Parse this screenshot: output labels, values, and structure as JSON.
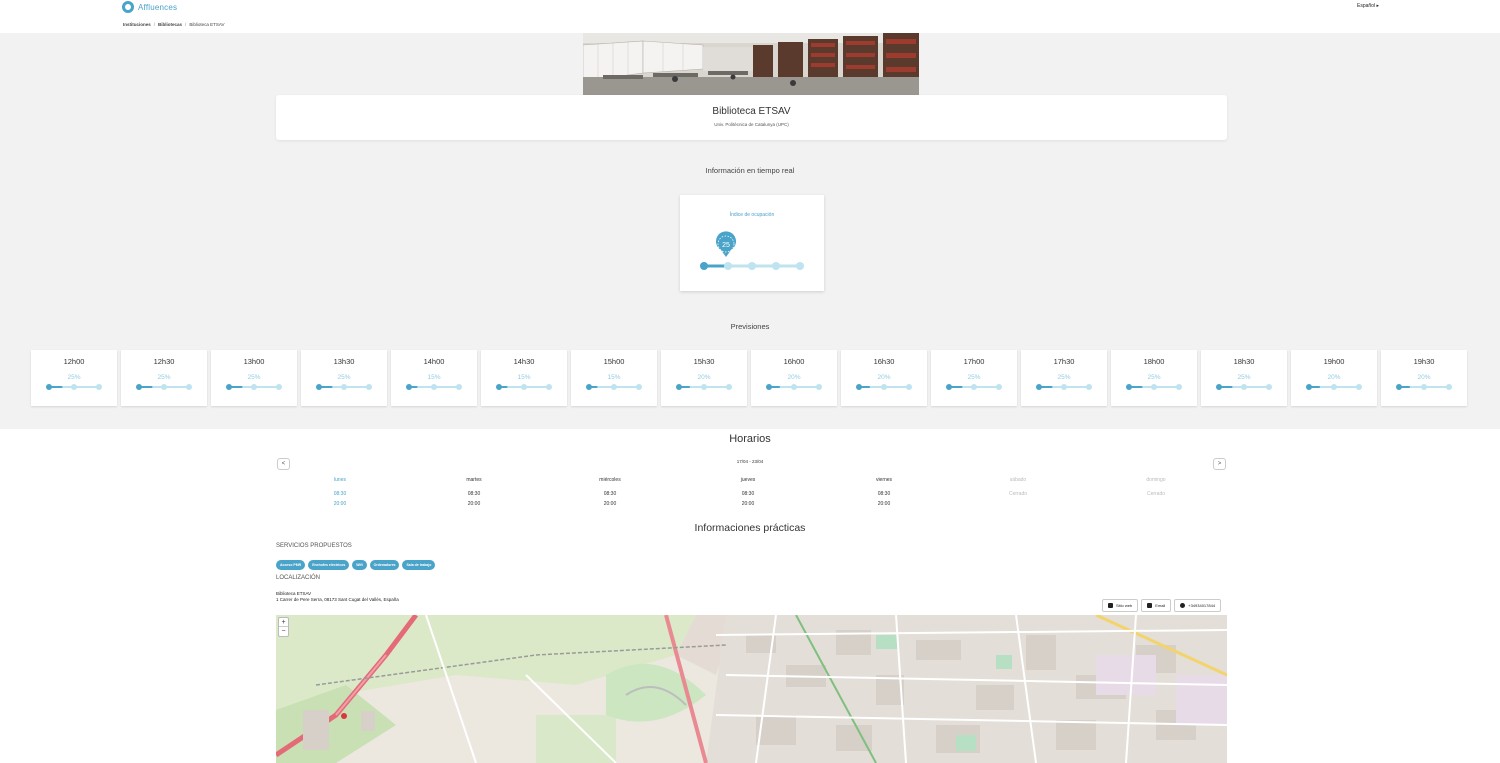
{
  "header": {
    "brand": "Affluences",
    "language": "Español ▸"
  },
  "breadcrumb": [
    {
      "label": "Instituciones"
    },
    {
      "label": "Bibliotecas"
    },
    {
      "label": "Biblioteca ETSAV"
    }
  ],
  "library": {
    "name": "Biblioteca ETSAV",
    "institution": "Univ. Politècnica de Catalunya (UPC)"
  },
  "realtime": {
    "title": "Información en tiempo real",
    "occupancy_label": "Índice de ocupación",
    "occupancy_value": "25",
    "occupancy_fraction": 0.25
  },
  "forecast": {
    "title": "Previsiones",
    "slots": [
      {
        "time": "12h00",
        "pct": "25%"
      },
      {
        "time": "12h30",
        "pct": "25%"
      },
      {
        "time": "13h00",
        "pct": "25%"
      },
      {
        "time": "13h30",
        "pct": "25%"
      },
      {
        "time": "14h00",
        "pct": "15%"
      },
      {
        "time": "14h30",
        "pct": "15%"
      },
      {
        "time": "15h00",
        "pct": "15%"
      },
      {
        "time": "15h30",
        "pct": "20%"
      },
      {
        "time": "16h00",
        "pct": "20%"
      },
      {
        "time": "16h30",
        "pct": "20%"
      },
      {
        "time": "17h00",
        "pct": "25%"
      },
      {
        "time": "17h30",
        "pct": "25%"
      },
      {
        "time": "18h00",
        "pct": "25%"
      },
      {
        "time": "18h30",
        "pct": "25%"
      },
      {
        "time": "19h00",
        "pct": "20%"
      },
      {
        "time": "19h30",
        "pct": "20%"
      }
    ]
  },
  "schedule": {
    "title": "Horarios",
    "prev": "<",
    "next": ">",
    "week": "17/04 - 23/04",
    "days": [
      {
        "name": "lunes",
        "open": "08:30",
        "close": "20:00",
        "status": "",
        "today": true,
        "closed": false
      },
      {
        "name": "martes",
        "open": "08:30",
        "close": "20:00",
        "status": "",
        "today": false,
        "closed": false
      },
      {
        "name": "miércoles",
        "open": "08:30",
        "close": "20:00",
        "status": "",
        "today": false,
        "closed": false
      },
      {
        "name": "jueves",
        "open": "08:30",
        "close": "20:00",
        "status": "",
        "today": false,
        "closed": false
      },
      {
        "name": "viernes",
        "open": "08:30",
        "close": "20:00",
        "status": "",
        "today": false,
        "closed": false
      },
      {
        "name": "sábado",
        "open": "",
        "close": "",
        "status": "Cerrado",
        "today": false,
        "closed": true
      },
      {
        "name": "domingo",
        "open": "",
        "close": "",
        "status": "Cerrado",
        "today": false,
        "closed": true
      }
    ]
  },
  "practical": {
    "title": "Informaciones prácticas",
    "services_label": "SERVICIOS PROPUESTOS",
    "services": [
      "Acceso PMR",
      "Enchufes eléctricos",
      "Wifi",
      "Ordenadores",
      "Sala de trabajo"
    ],
    "location_label": "LOCALIZACIÓN",
    "address_name": "Biblioteca ETSAV",
    "address_line": "1 Carrer de Pere Serra, 08173 Sant Cugat del Vallès, España",
    "contacts": {
      "website": "Sitio web",
      "email": "Email",
      "phone": "+34934017844"
    }
  },
  "map": {
    "zoom_in": "+",
    "zoom_out": "−"
  },
  "colors": {
    "accent": "#4aa3c8",
    "accent_light": "#bfe3ef",
    "background_band": "#f2f2f2"
  }
}
